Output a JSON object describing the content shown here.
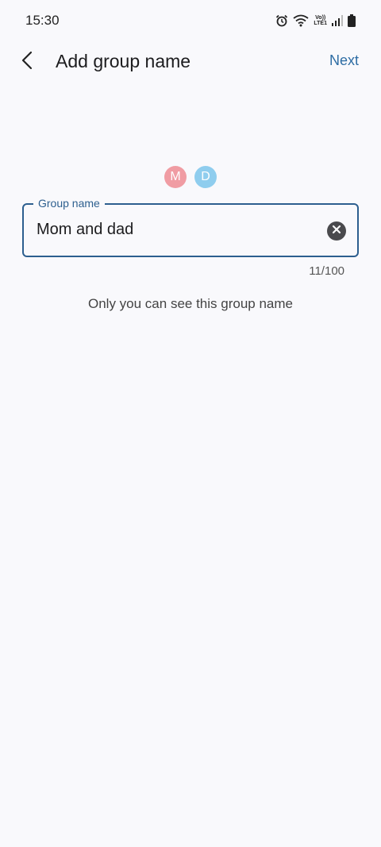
{
  "status_bar": {
    "time": "15:30",
    "icons": [
      "alarm-icon",
      "wifi-icon",
      "volte-lte-icon",
      "signal-icon",
      "battery-icon"
    ],
    "lte_top": "Vo))",
    "lte_bottom": "LTE1"
  },
  "app_bar": {
    "back_icon": "chevron-left-icon",
    "title": "Add group name",
    "next_label": "Next"
  },
  "avatars": [
    {
      "initial": "M",
      "color": "#f09ca3"
    },
    {
      "initial": "D",
      "color": "#8fcdee"
    }
  ],
  "group_name_field": {
    "label": "Group name",
    "value": "Mom and dad",
    "clear_icon": "clear-icon"
  },
  "counter": "11/100",
  "helper_text": "Only you can see this group name",
  "colors": {
    "accent": "#2d5f8f",
    "next": "#2e6da4",
    "background": "#f9f9fc"
  }
}
